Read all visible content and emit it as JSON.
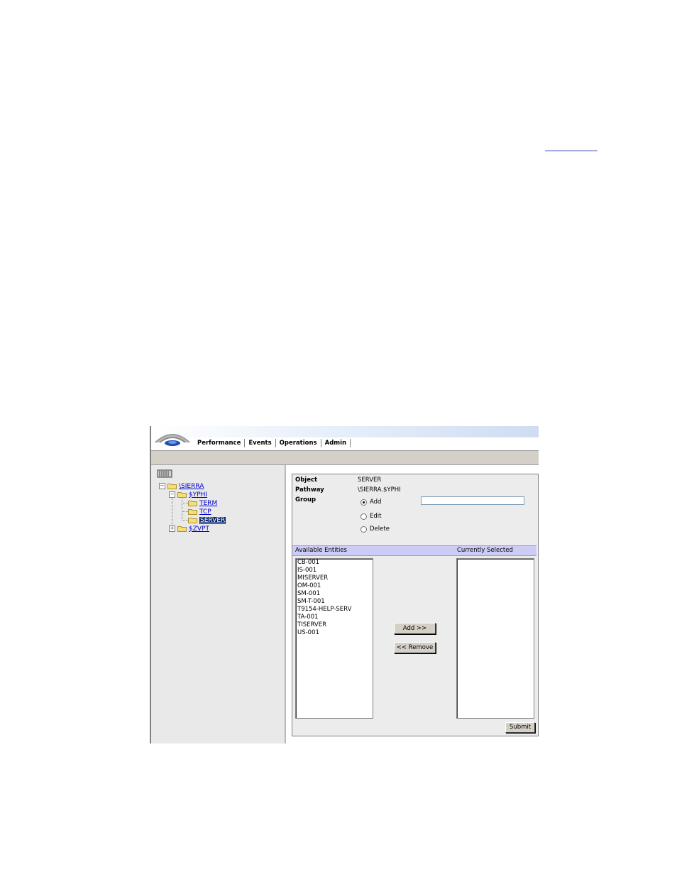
{
  "app": {
    "menu": [
      "Performance",
      "Events",
      "Operations",
      "Admin"
    ]
  },
  "tree": {
    "root": "\\SIERRA",
    "children": [
      {
        "label": "$YPHI",
        "children": [
          "TERM",
          "TCP",
          "SERVER"
        ]
      },
      {
        "label": "$ZVPT"
      }
    ],
    "selected": "SERVER"
  },
  "properties": {
    "object_label": "Object",
    "object_value": "SERVER",
    "pathway_label": "Pathway",
    "pathway_value": "\\SIERRA.$YPHI",
    "group_label": "Group",
    "group_value": ""
  },
  "group_options": [
    {
      "label": "Add",
      "checked": true
    },
    {
      "label": "Edit",
      "checked": false
    },
    {
      "label": "Delete",
      "checked": false
    }
  ],
  "entities": {
    "available_header": "Available Entities",
    "selected_header": "Currently Selected",
    "available": [
      "CB-001",
      "IS-001",
      "MISERVER",
      "OM-001",
      "SM-001",
      "SM-T-001",
      "T9154-HELP-SERV",
      "TA-001",
      "TISERVER",
      "US-001"
    ],
    "selected": []
  },
  "buttons": {
    "add": "Add >>",
    "remove": "<< Remove",
    "submit": "Submit"
  }
}
